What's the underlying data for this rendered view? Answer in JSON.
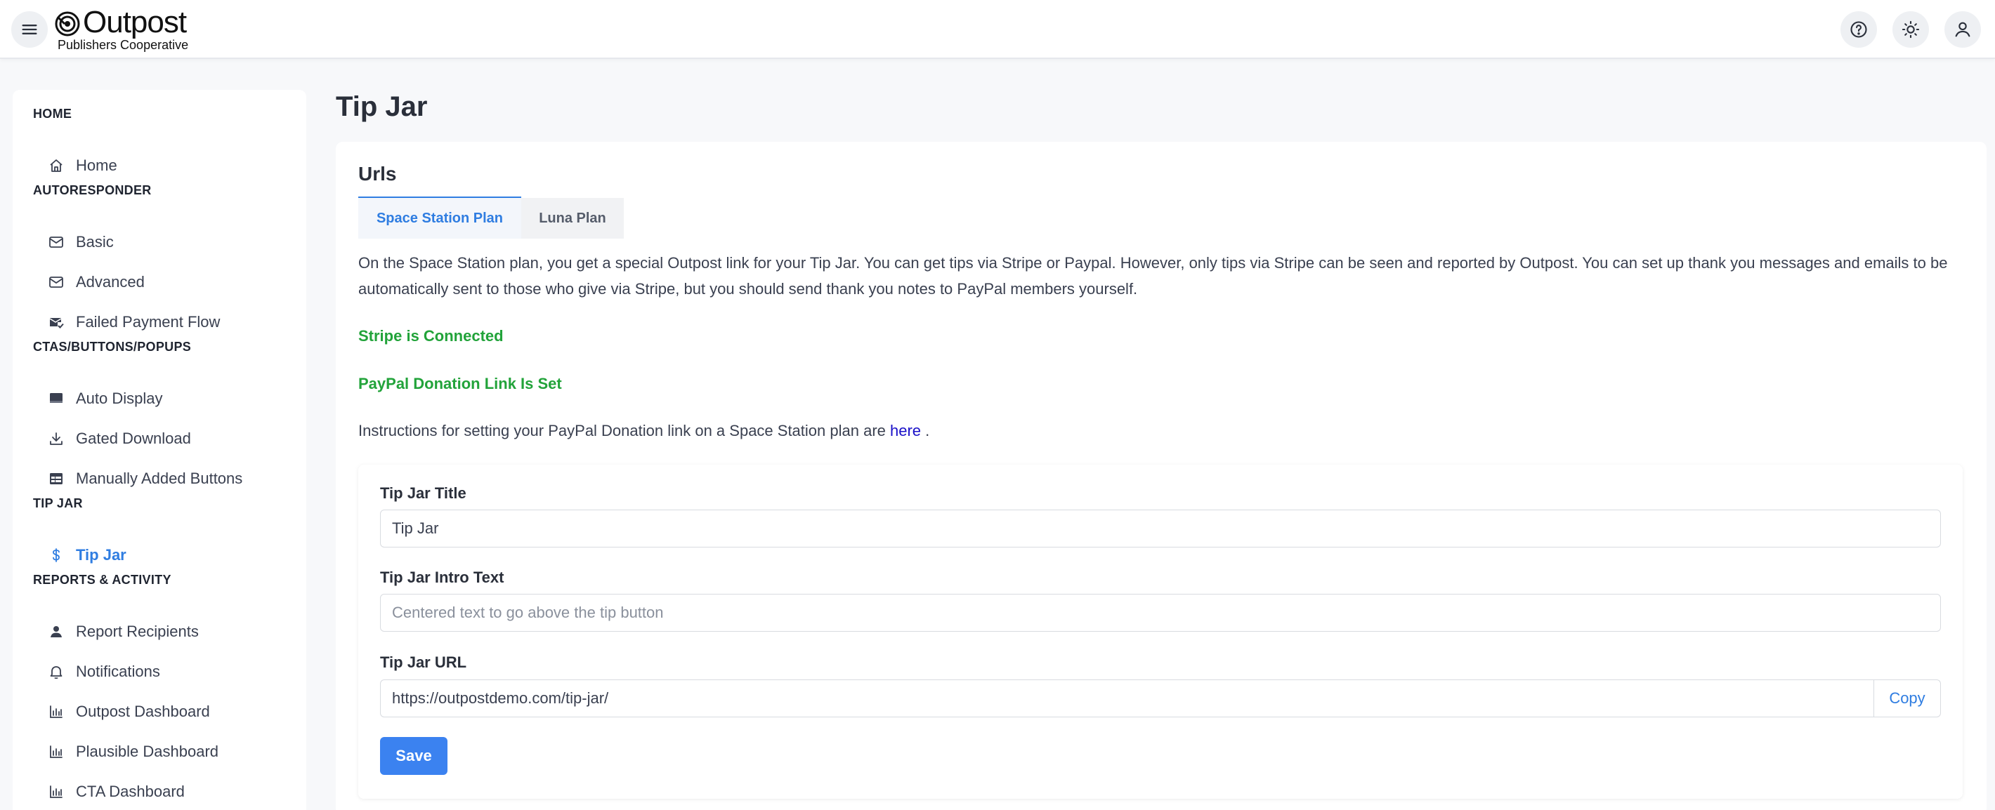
{
  "header": {
    "logo_name": "Outpost",
    "logo_sub": "Publishers Cooperative",
    "icons": [
      "menu-icon",
      "help-icon",
      "sun-icon",
      "user-icon"
    ]
  },
  "sidebar": {
    "sections": [
      {
        "heading": "HOME",
        "items": [
          {
            "label": "Home",
            "icon": "home-icon"
          }
        ]
      },
      {
        "heading": "AUTORESPONDER",
        "items": [
          {
            "label": "Basic",
            "icon": "mail-icon"
          },
          {
            "label": "Advanced",
            "icon": "mail-icon"
          },
          {
            "label": "Failed Payment Flow",
            "icon": "mail-check-icon"
          }
        ]
      },
      {
        "heading": "CTAS/BUTTONS/POPUPS",
        "items": [
          {
            "label": "Auto Display",
            "icon": "display-icon"
          },
          {
            "label": "Gated Download",
            "icon": "download-icon"
          },
          {
            "label": "Manually Added Buttons",
            "icon": "table-icon"
          }
        ]
      },
      {
        "heading": "TIP JAR",
        "items": [
          {
            "label": "Tip Jar",
            "icon": "dollar-icon",
            "active": true
          }
        ]
      },
      {
        "heading": "REPORTS & ACTIVITY",
        "items": [
          {
            "label": "Report Recipients",
            "icon": "person-icon"
          },
          {
            "label": "Notifications",
            "icon": "bell-icon"
          },
          {
            "label": "Outpost Dashboard",
            "icon": "bar-chart-icon"
          },
          {
            "label": "Plausible Dashboard",
            "icon": "bar-chart-icon"
          },
          {
            "label": "CTA Dashboard",
            "icon": "bar-chart-icon"
          }
        ]
      }
    ]
  },
  "main": {
    "page_title": "Tip Jar",
    "card_title": "Urls",
    "tabs": [
      {
        "label": "Space Station Plan",
        "active": true
      },
      {
        "label": "Luna Plan",
        "active": false
      }
    ],
    "description": "On the Space Station plan, you get a special Outpost link for your Tip Jar. You can get tips via Stripe or Paypal. However, only tips via Stripe can be seen and reported by Outpost. You can set up thank you messages and emails to be automatically sent to those who give via Stripe, but you should send thank you notes to PayPal members yourself.",
    "stripe_status": "Stripe is Connected",
    "paypal_status": "PayPal Donation Link Is Set",
    "instructions_prefix": "Instructions for setting your PayPal Donation link on a Space Station plan are ",
    "instructions_link": "here",
    "instructions_suffix": " .",
    "form": {
      "title_label": "Tip Jar Title",
      "title_value": "Tip Jar",
      "intro_label": "Tip Jar Intro Text",
      "intro_value": "",
      "intro_placeholder": "Centered text to go above the tip button",
      "url_label": "Tip Jar URL",
      "url_value": "https://outpostdemo.com/tip-jar/",
      "copy_label": "Copy",
      "save_label": "Save"
    }
  },
  "colors": {
    "accent": "#2f7de1",
    "success": "#22a33a",
    "link": "#1a10c8",
    "save_button": "#3b82f0"
  }
}
